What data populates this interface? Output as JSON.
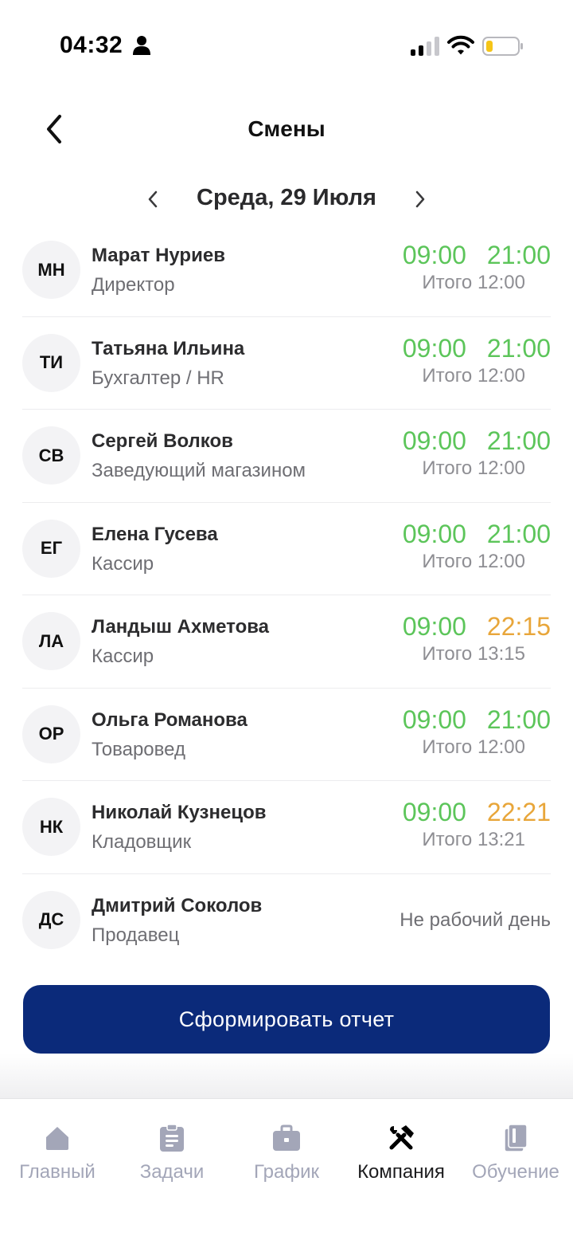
{
  "status_bar": {
    "time": "04:32",
    "icons": [
      "person-icon",
      "signal-icon",
      "wifi-icon",
      "battery-icon"
    ]
  },
  "header": {
    "title": "Смены",
    "back_icon": "chevron-left-icon"
  },
  "date_nav": {
    "label": "Среда, 29 Июля",
    "prev_icon": "chevron-left-icon",
    "next_icon": "chevron-right-icon"
  },
  "colors": {
    "on_time": "#5cc55a",
    "overtime": "#e8a63a",
    "button": "#0b2a7a",
    "tab_inactive": "#a3a6b8",
    "tab_active": "#1c1c1e"
  },
  "employees": [
    {
      "initials": "МН",
      "name": "Марат Нуриев",
      "role": "Директор",
      "start": "09:00",
      "end": "21:00",
      "total": "Итого 12:00",
      "end_status": "on_time"
    },
    {
      "initials": "ТИ",
      "name": "Татьяна Ильина",
      "role": "Бухгалтер / HR",
      "start": "09:00",
      "end": "21:00",
      "total": "Итого 12:00",
      "end_status": "on_time"
    },
    {
      "initials": "СВ",
      "name": "Сергей Волков",
      "role": "Заведующий магазином",
      "start": "09:00",
      "end": "21:00",
      "total": "Итого 12:00",
      "end_status": "on_time"
    },
    {
      "initials": "ЕГ",
      "name": "Елена Гусева",
      "role": "Кассир",
      "start": "09:00",
      "end": "21:00",
      "total": "Итого 12:00",
      "end_status": "on_time"
    },
    {
      "initials": "ЛА",
      "name": "Ландыш Ахметова",
      "role": "Кассир",
      "start": "09:00",
      "end": "22:15",
      "total": "Итого 13:15",
      "end_status": "overtime"
    },
    {
      "initials": "ОР",
      "name": "Ольга Романова",
      "role": "Товаровед",
      "start": "09:00",
      "end": "21:00",
      "total": "Итого 12:00",
      "end_status": "on_time"
    },
    {
      "initials": "НК",
      "name": "Николай Кузнецов",
      "role": "Кладовщик",
      "start": "09:00",
      "end": "22:21",
      "total": "Итого 13:21",
      "end_status": "overtime"
    },
    {
      "initials": "ДС",
      "name": "Дмитрий Соколов",
      "role": "Продавец",
      "non_working": "Не рабочий день"
    }
  ],
  "report_button": {
    "label": "Сформировать отчет"
  },
  "tab_bar": {
    "tabs": [
      {
        "label": "Главный",
        "icon": "home-icon",
        "active": false
      },
      {
        "label": "Задачи",
        "icon": "clipboard-icon",
        "active": false
      },
      {
        "label": "График",
        "icon": "briefcase-icon",
        "active": false
      },
      {
        "label": "Компания",
        "icon": "tools-icon",
        "active": true
      },
      {
        "label": "Обучение",
        "icon": "book-icon",
        "active": false
      }
    ]
  }
}
